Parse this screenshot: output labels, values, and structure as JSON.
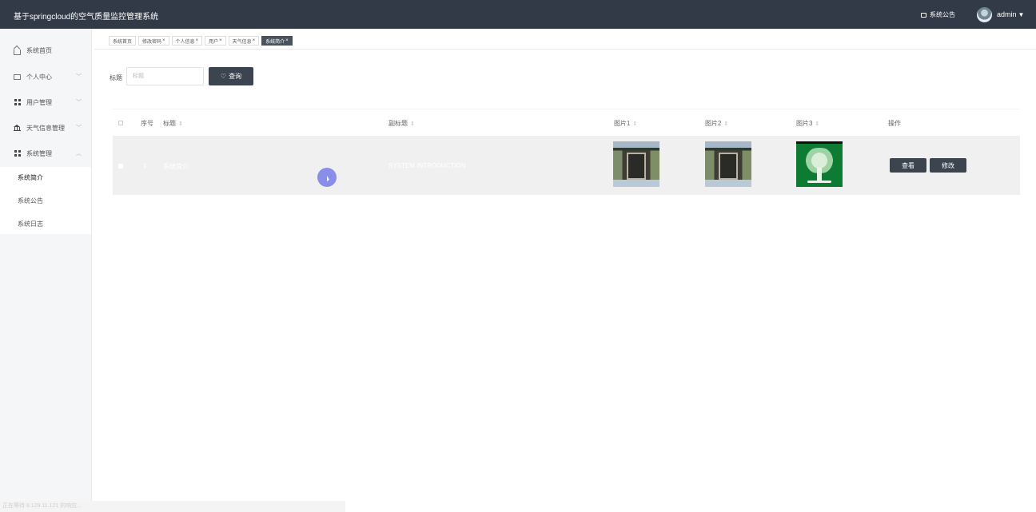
{
  "app": {
    "title": "基于springcloud的空气质量监控管理系统"
  },
  "header": {
    "notice_label": "系统公告",
    "user_name": "admin",
    "caret": "▼"
  },
  "sidebar": {
    "items": [
      {
        "label": "系统首页",
        "arrow": ""
      },
      {
        "label": "个人中心",
        "arrow": "﹀"
      },
      {
        "label": "用户管理",
        "arrow": "﹀"
      },
      {
        "label": "天气信息管理",
        "arrow": "﹀"
      },
      {
        "label": "系统管理",
        "arrow": "︿"
      }
    ],
    "subitems": [
      "系统简介",
      "系统公告",
      "系统日志"
    ]
  },
  "tabs": [
    {
      "label": "系统首页",
      "closable": false
    },
    {
      "label": "修改密码",
      "closable": true
    },
    {
      "label": "个人信息",
      "closable": true
    },
    {
      "label": "用户",
      "closable": true
    },
    {
      "label": "天气信息",
      "closable": true
    },
    {
      "label": "系统简介",
      "closable": true
    }
  ],
  "tab_close": "×",
  "search": {
    "label": "标题",
    "placeholder": "标题",
    "button_label": "查询"
  },
  "table": {
    "headers": {
      "index": "序号",
      "title": "标题",
      "subtitle": "副标题",
      "pic1": "图片1",
      "pic2": "图片2",
      "pic3": "图片3",
      "actions": "操作"
    },
    "sort_icon": "⇕",
    "rows": [
      {
        "index": "1",
        "title": "系统简介",
        "subtitle": "SYSTEM INTRODUCTION",
        "view_label": "查看",
        "edit_label": "修改"
      }
    ]
  },
  "status_bar": {
    "text": "正在等待 8.129.11.121 的响应..."
  }
}
